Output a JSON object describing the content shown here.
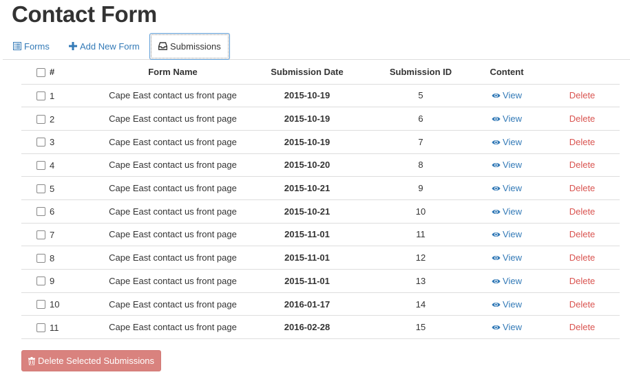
{
  "page": {
    "title": "Contact Form"
  },
  "nav": {
    "tabs": [
      {
        "label": "Forms",
        "icon": "list-icon",
        "active": false
      },
      {
        "label": "Add New Form",
        "icon": "plus-icon",
        "active": false
      },
      {
        "label": "Submissions",
        "icon": "inbox-icon",
        "active": true
      }
    ]
  },
  "table": {
    "headers": {
      "number": "#",
      "form_name": "Form Name",
      "submission_date": "Submission Date",
      "submission_id": "Submission ID",
      "content": "Content"
    },
    "rows": [
      {
        "num": "1",
        "form_name": "Cape East contact us front page",
        "date": "2015-10-19",
        "id": "5",
        "view": "View",
        "delete": "Delete"
      },
      {
        "num": "2",
        "form_name": "Cape East contact us front page",
        "date": "2015-10-19",
        "id": "6",
        "view": "View",
        "delete": "Delete"
      },
      {
        "num": "3",
        "form_name": "Cape East contact us front page",
        "date": "2015-10-19",
        "id": "7",
        "view": "View",
        "delete": "Delete"
      },
      {
        "num": "4",
        "form_name": "Cape East contact us front page",
        "date": "2015-10-20",
        "id": "8",
        "view": "View",
        "delete": "Delete"
      },
      {
        "num": "5",
        "form_name": "Cape East contact us front page",
        "date": "2015-10-21",
        "id": "9",
        "view": "View",
        "delete": "Delete"
      },
      {
        "num": "6",
        "form_name": "Cape East contact us front page",
        "date": "2015-10-21",
        "id": "10",
        "view": "View",
        "delete": "Delete"
      },
      {
        "num": "7",
        "form_name": "Cape East contact us front page",
        "date": "2015-11-01",
        "id": "11",
        "view": "View",
        "delete": "Delete"
      },
      {
        "num": "8",
        "form_name": "Cape East contact us front page",
        "date": "2015-11-01",
        "id": "12",
        "view": "View",
        "delete": "Delete"
      },
      {
        "num": "9",
        "form_name": "Cape East contact us front page",
        "date": "2015-11-01",
        "id": "13",
        "view": "View",
        "delete": "Delete"
      },
      {
        "num": "10",
        "form_name": "Cape East contact us front page",
        "date": "2016-01-17",
        "id": "14",
        "view": "View",
        "delete": "Delete"
      },
      {
        "num": "11",
        "form_name": "Cape East contact us front page",
        "date": "2016-02-28",
        "id": "15",
        "view": "View",
        "delete": "Delete"
      }
    ]
  },
  "actions": {
    "delete_selected_label": "Delete Selected Submissions"
  },
  "colors": {
    "link": "#337ab7",
    "danger": "#d9534f",
    "danger_button": "#d9827e",
    "border": "#dddddd"
  }
}
